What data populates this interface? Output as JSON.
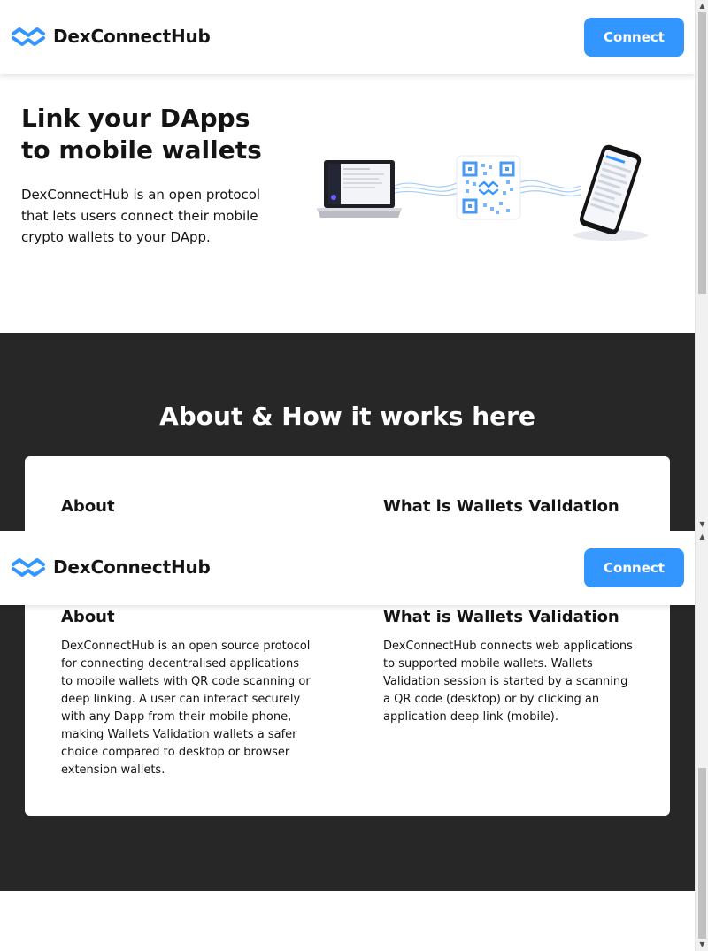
{
  "brand": {
    "name": "DexConnectHub",
    "logo_icon": "walletconnect-wave-icon",
    "accent_color": "#3396ff"
  },
  "navbar": {
    "connect_label": "Connect"
  },
  "hero": {
    "title": "Link your DApps to mobile wallets",
    "description": "DexConnectHub is an open protocol that lets users connect their mobile crypto wallets to your DApp.",
    "illustration_icons": [
      "laptop-icon",
      "qr-code-icon",
      "smartphone-icon"
    ]
  },
  "about_section": {
    "heading": "About & How it works here",
    "background_color": "#272727",
    "about": {
      "title": "About",
      "text": "DexConnectHub is an open source protocol for connecting decentralised applications to mobile wallets with QR code scanning or deep linking. A user can interact securely with any Dapp from their mobile phone, making Wallets Validation wallets a safer choice compared to desktop or browser extension wallets."
    },
    "validation": {
      "title": "What is Wallets Validation",
      "text": "DexConnectHub connects web applications to supported mobile wallets. Wallets Validation session is started by a scanning a QR code (desktop) or by clicking an application deep link (mobile)."
    }
  },
  "scrollbar": {
    "up_icon": "scroll-up-arrow-icon",
    "down_icon": "scroll-down-arrow-icon"
  }
}
